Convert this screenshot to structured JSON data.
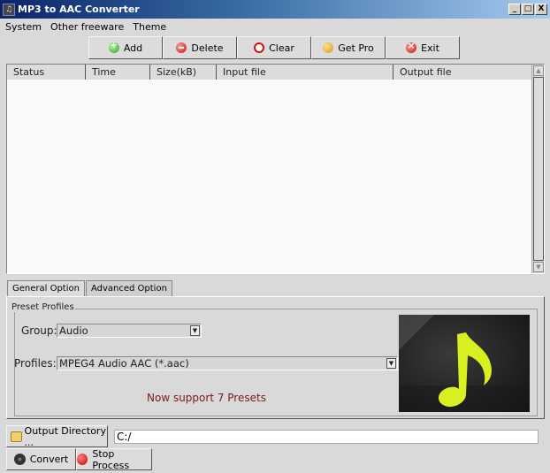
{
  "window": {
    "title": "MP3 to AAC Converter",
    "controls": [
      "minimize",
      "maximize",
      "close"
    ]
  },
  "menu": {
    "items": [
      {
        "label": "System",
        "mnemonic": "S"
      },
      {
        "label": "Other freeware",
        "mnemonic": "O"
      },
      {
        "label": "Theme",
        "mnemonic": "T"
      }
    ]
  },
  "toolbar": {
    "buttons": [
      {
        "label": "Add",
        "icon": "add-icon"
      },
      {
        "label": "Delete",
        "icon": "delete-icon"
      },
      {
        "label": "Clear",
        "icon": "clear-icon"
      },
      {
        "label": "Get Pro",
        "icon": "smiley-icon"
      },
      {
        "label": "Exit",
        "icon": "exit-icon"
      }
    ]
  },
  "file_list": {
    "columns": [
      "Status",
      "Time",
      "Size(kB)",
      "Input file",
      "Output file"
    ],
    "rows": []
  },
  "tabs": [
    {
      "label": "General Option",
      "active": true
    },
    {
      "label": "Advanced Option",
      "active": false
    }
  ],
  "preset": {
    "group_title": "Preset Profiles",
    "group_label": "Group:",
    "group_value": "Audio",
    "profiles_label": "Profiles:",
    "profiles_value": "MPEG4 Audio AAC (*.aac)",
    "note": "Now support 7 Presets",
    "note_color": "#7a1a1a",
    "art_icon": "music-note-icon",
    "art_color": "#d8f020"
  },
  "output": {
    "dir_button": "Output Directory ...",
    "dir_value": "C:/"
  },
  "actions": {
    "convert": "Convert",
    "stop": "Stop Process"
  }
}
